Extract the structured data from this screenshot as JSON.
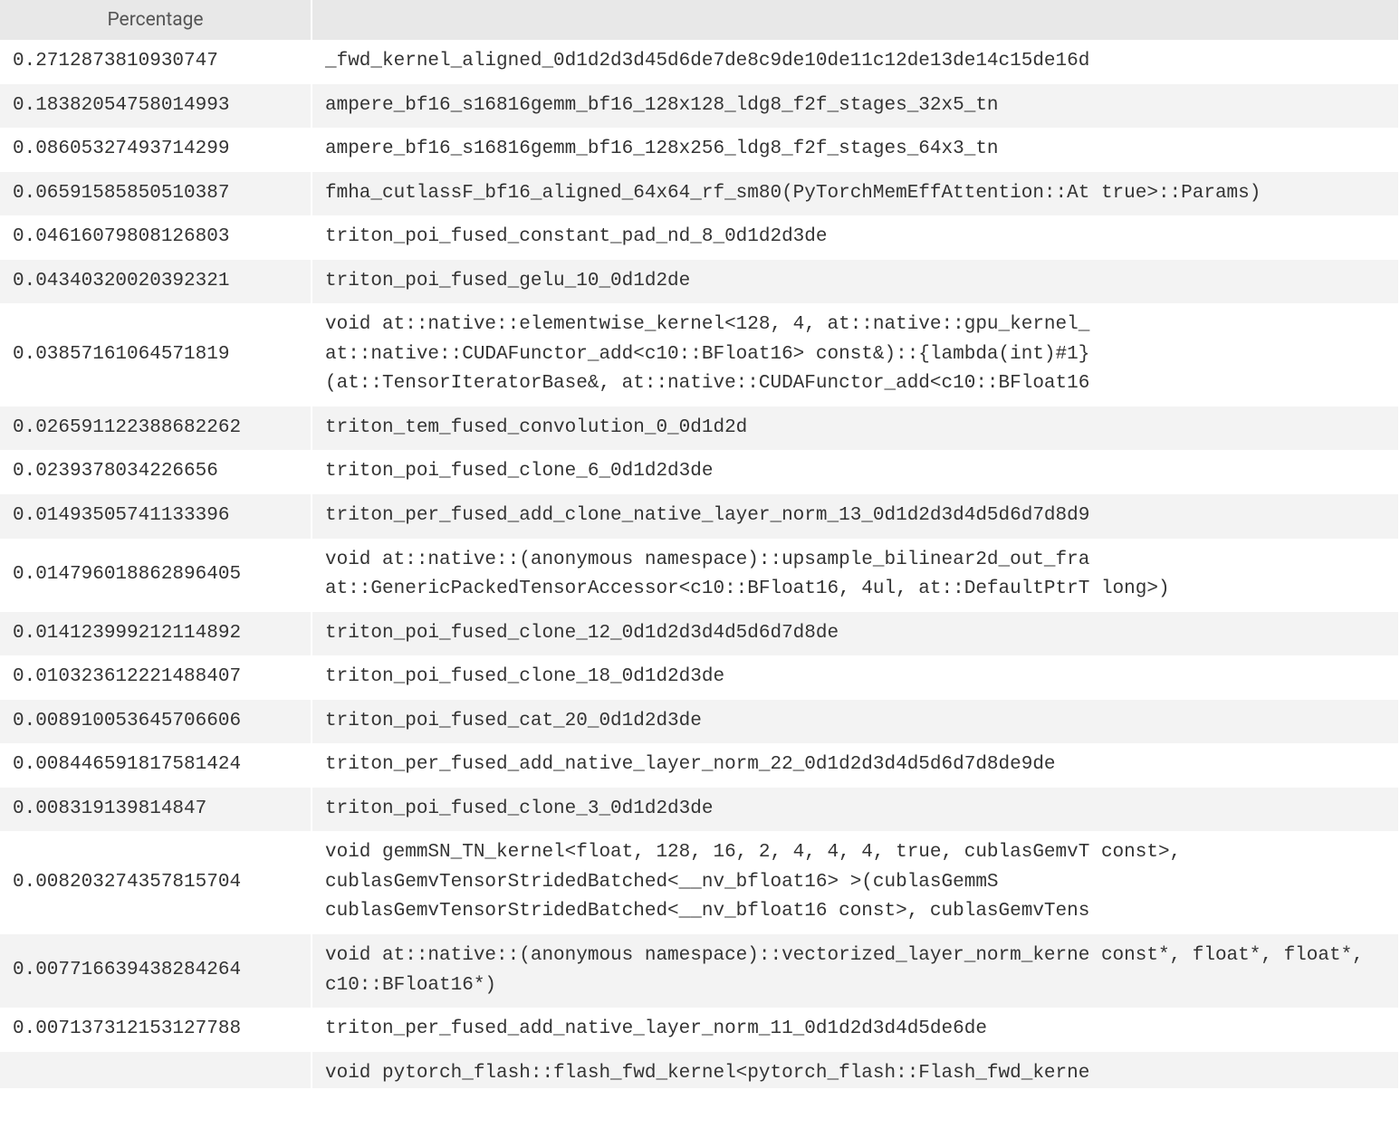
{
  "table": {
    "columns": {
      "percentage": "Percentage",
      "name": ""
    },
    "rows": [
      {
        "percentage": "0.2712873810930747",
        "name": "_fwd_kernel_aligned_0d1d2d3d45d6de7de8c9de10de11c12de13de14c15de16d"
      },
      {
        "percentage": "0.18382054758014993",
        "name": "ampere_bf16_s16816gemm_bf16_128x128_ldg8_f2f_stages_32x5_tn"
      },
      {
        "percentage": "0.08605327493714299",
        "name": "ampere_bf16_s16816gemm_bf16_128x256_ldg8_f2f_stages_64x3_tn"
      },
      {
        "percentage": "0.06591585850510387",
        "name": "fmha_cutlassF_bf16_aligned_64x64_rf_sm80(PyTorchMemEffAttention::At true>::Params)"
      },
      {
        "percentage": "0.04616079808126803",
        "name": "triton_poi_fused_constant_pad_nd_8_0d1d2d3de"
      },
      {
        "percentage": "0.04340320020392321",
        "name": "triton_poi_fused_gelu_10_0d1d2de"
      },
      {
        "percentage": "0.03857161064571819",
        "name": "void at::native::elementwise_kernel<128, 4, at::native::gpu_kernel_ at::native::CUDAFunctor_add<c10::BFloat16> const&)::{lambda(int)#1} (at::TensorIteratorBase&, at::native::CUDAFunctor_add<c10::BFloat16"
      },
      {
        "percentage": "0.026591122388682262",
        "name": "triton_tem_fused_convolution_0_0d1d2d"
      },
      {
        "percentage": "0.0239378034226656",
        "name": "triton_poi_fused_clone_6_0d1d2d3de"
      },
      {
        "percentage": "0.01493505741133396",
        "name": "triton_per_fused_add_clone_native_layer_norm_13_0d1d2d3d4d5d6d7d8d9"
      },
      {
        "percentage": "0.014796018862896405",
        "name": "void at::native::(anonymous namespace)::upsample_bilinear2d_out_fra at::GenericPackedTensorAccessor<c10::BFloat16, 4ul, at::DefaultPtrT long>)"
      },
      {
        "percentage": "0.014123999212114892",
        "name": "triton_poi_fused_clone_12_0d1d2d3d4d5d6d7d8de"
      },
      {
        "percentage": "0.010323612221488407",
        "name": "triton_poi_fused_clone_18_0d1d2d3de"
      },
      {
        "percentage": "0.008910053645706606",
        "name": "triton_poi_fused_cat_20_0d1d2d3de"
      },
      {
        "percentage": "0.008446591817581424",
        "name": "triton_per_fused_add_native_layer_norm_22_0d1d2d3d4d5d6d7d8de9de"
      },
      {
        "percentage": "0.008319139814847",
        "name": "triton_poi_fused_clone_3_0d1d2d3de"
      },
      {
        "percentage": "0.008203274357815704",
        "name": "void gemmSN_TN_kernel<float, 128, 16, 2, 4, 4, 4, true, cublasGemvT const>, cublasGemvTensorStridedBatched<__nv_bfloat16> >(cublasGemmS cublasGemvTensorStridedBatched<__nv_bfloat16 const>, cublasGemvTens"
      },
      {
        "percentage": "0.007716639438284264",
        "name": "void at::native::(anonymous namespace)::vectorized_layer_norm_kerne const*, float*, float*, c10::BFloat16*)"
      },
      {
        "percentage": "0.007137312153127788",
        "name": "triton_per_fused_add_native_layer_norm_11_0d1d2d3d4d5de6de"
      },
      {
        "percentage": "",
        "name": "void pytorch_flash::flash_fwd_kernel<pytorch_flash::Flash_fwd_kerne"
      }
    ]
  }
}
